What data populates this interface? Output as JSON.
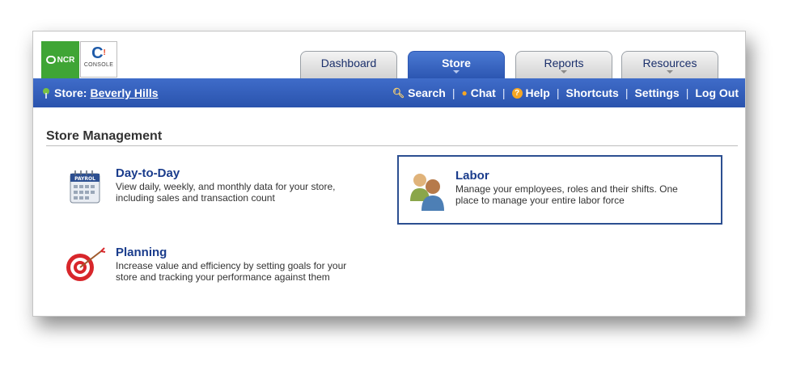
{
  "logos": {
    "ncr_text": "NCR",
    "console_text": "CONSOLE"
  },
  "tabs": [
    {
      "label": "Dashboard",
      "active": false
    },
    {
      "label": "Store",
      "active": true
    },
    {
      "label": "Reports",
      "active": false
    },
    {
      "label": "Resources",
      "active": false
    }
  ],
  "store_bar": {
    "store_label": "Store:",
    "store_name": "Beverly Hills",
    "links": [
      "Search",
      "Chat",
      "Help",
      "Shortcuts",
      "Settings",
      "Log Out"
    ],
    "separator": "|"
  },
  "main": {
    "section_title": "Store Management",
    "cards": [
      {
        "title": "Day-to-Day",
        "description_lines": [
          "View daily, weekly, and monthly data for your store,",
          "including sales and transaction count"
        ],
        "icon": "calendar-icon",
        "calendar_label": "PAYROL"
      },
      {
        "title": "Labor",
        "description_lines": [
          "Manage your employees, roles and their shifts. One",
          "place to manage your entire labor force"
        ],
        "icon": "people-icon"
      },
      {
        "title": "Planning",
        "description_lines": [
          "Increase value and efficiency by setting goals for your",
          "store and tracking your performance against them"
        ],
        "icon": "target-icon"
      }
    ]
  },
  "colors": {
    "nav_bar": "#2f5bb6",
    "active_tab": "#3a68c6",
    "card_title": "#1a3c8c",
    "ncr_green": "#3fa535"
  }
}
